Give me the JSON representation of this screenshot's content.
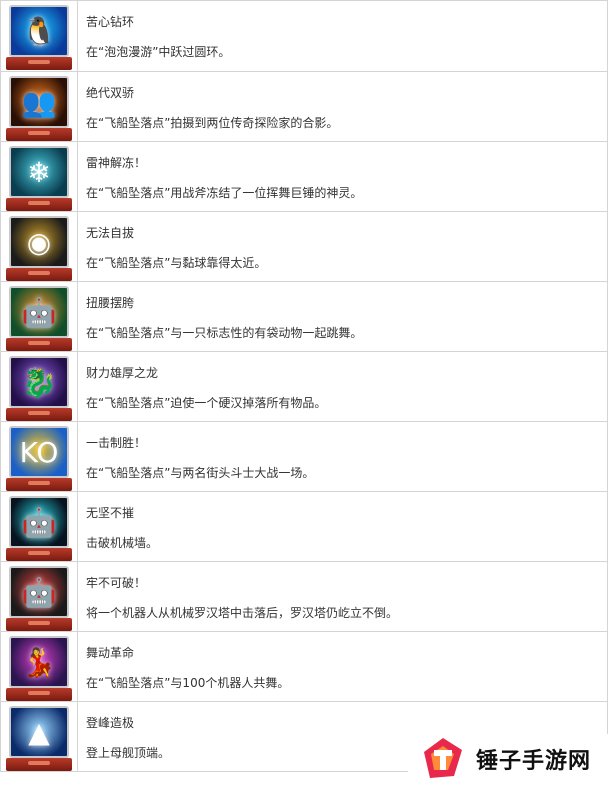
{
  "trophies": [
    {
      "icon": "penguin-ring-icon",
      "title": "苦心钻环",
      "desc": "在“泡泡漫游”中跃过圆环。",
      "colors": [
        "#0a3a9a",
        "#1ec3ff"
      ],
      "glyph": "🐧"
    },
    {
      "icon": "silhouette-duo-icon",
      "title": "绝代双骄",
      "desc": "在“飞船坠落点”拍摄到两位传奇探险家的合影。",
      "colors": [
        "#2a0f05",
        "#e8761e"
      ],
      "glyph": "👥"
    },
    {
      "icon": "frozen-god-icon",
      "title": "雷神解冻！",
      "desc": "在“飞船坠落点”用战斧冻结了一位挥舞巨锤的神灵。",
      "colors": [
        "#0a3d50",
        "#46c8d8"
      ],
      "glyph": "❄"
    },
    {
      "icon": "sticky-ball-icon",
      "title": "无法自拔",
      "desc": "在“飞船坠落点”与黏球靠得太近。",
      "colors": [
        "#1b1b1b",
        "#c79a28"
      ],
      "glyph": "◉"
    },
    {
      "icon": "dancing-robot-icon",
      "title": "扭腰摆胯",
      "desc": "在“飞船坠落点”与一只标志性的有袋动物一起跳舞。",
      "colors": [
        "#0f4f2a",
        "#e88a2a"
      ],
      "glyph": "🤖"
    },
    {
      "icon": "dragon-icon",
      "title": "财力雄厚之龙",
      "desc": "在“飞船坠落点”迫使一个硬汉掉落所有物品。",
      "colors": [
        "#23104a",
        "#8d5ad8"
      ],
      "glyph": "🐉"
    },
    {
      "icon": "ko-burst-icon",
      "title": "一击制胜！",
      "desc": "在“飞船坠落点”与两名街头斗士大战一场。",
      "colors": [
        "#1a60c8",
        "#f3c21a"
      ],
      "glyph": "KO"
    },
    {
      "icon": "robot-spotlight-icon",
      "title": "无坚不摧",
      "desc": "击破机械墙。",
      "colors": [
        "#07131f",
        "#28d3e0"
      ],
      "glyph": "🤖"
    },
    {
      "icon": "robot-tower-icon",
      "title": "牢不可破！",
      "desc": "将一个机器人从机械罗汉塔中击落后，罗汉塔仍屹立不倒。",
      "colors": [
        "#1a1a1a",
        "#e04040"
      ],
      "glyph": "🤖"
    },
    {
      "icon": "robot-crowd-icon",
      "title": "舞动革命",
      "desc": "在“飞船坠落点”与100个机器人共舞。",
      "colors": [
        "#2a1550",
        "#d840c8"
      ],
      "glyph": "💃"
    },
    {
      "icon": "summit-spire-icon",
      "title": "登峰造极",
      "desc": "登上母舰顶端。",
      "colors": [
        "#0a2a6a",
        "#9bd8ff"
      ],
      "glyph": "▲"
    }
  ],
  "watermark": {
    "text": "锤子手游网",
    "icon": "hammer-logo-icon",
    "colors": [
      "#e8294c",
      "#ff8a3a"
    ]
  }
}
